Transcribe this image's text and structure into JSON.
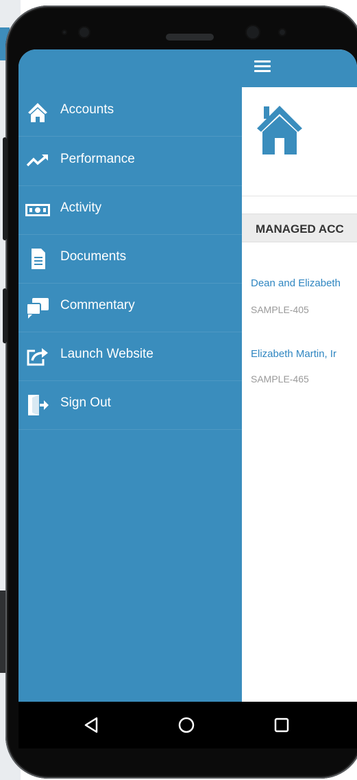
{
  "header": {
    "menu_icon": "hamburger-icon"
  },
  "drawer": {
    "items": [
      {
        "label": "Accounts",
        "icon": "home-icon"
      },
      {
        "label": "Performance",
        "icon": "trending-up-icon"
      },
      {
        "label": "Activity",
        "icon": "money-icon"
      },
      {
        "label": "Documents",
        "icon": "document-icon"
      },
      {
        "label": "Commentary",
        "icon": "chat-icon"
      },
      {
        "label": "Launch Website",
        "icon": "external-link-icon"
      },
      {
        "label": "Sign Out",
        "icon": "sign-out-icon"
      }
    ]
  },
  "main": {
    "section_title": "MANAGED ACC",
    "accounts": [
      {
        "name": "Dean and Elizabeth",
        "id": "SAMPLE-405"
      },
      {
        "name": "Elizabeth Martin, Ir",
        "id": "SAMPLE-465"
      }
    ]
  },
  "navbar": {
    "back": "back-triangle-icon",
    "home": "home-circle-icon",
    "recents": "recents-square-icon"
  },
  "colors": {
    "primary": "#3a8dbd",
    "link": "#2f86c1",
    "muted": "#9a9a9a"
  }
}
